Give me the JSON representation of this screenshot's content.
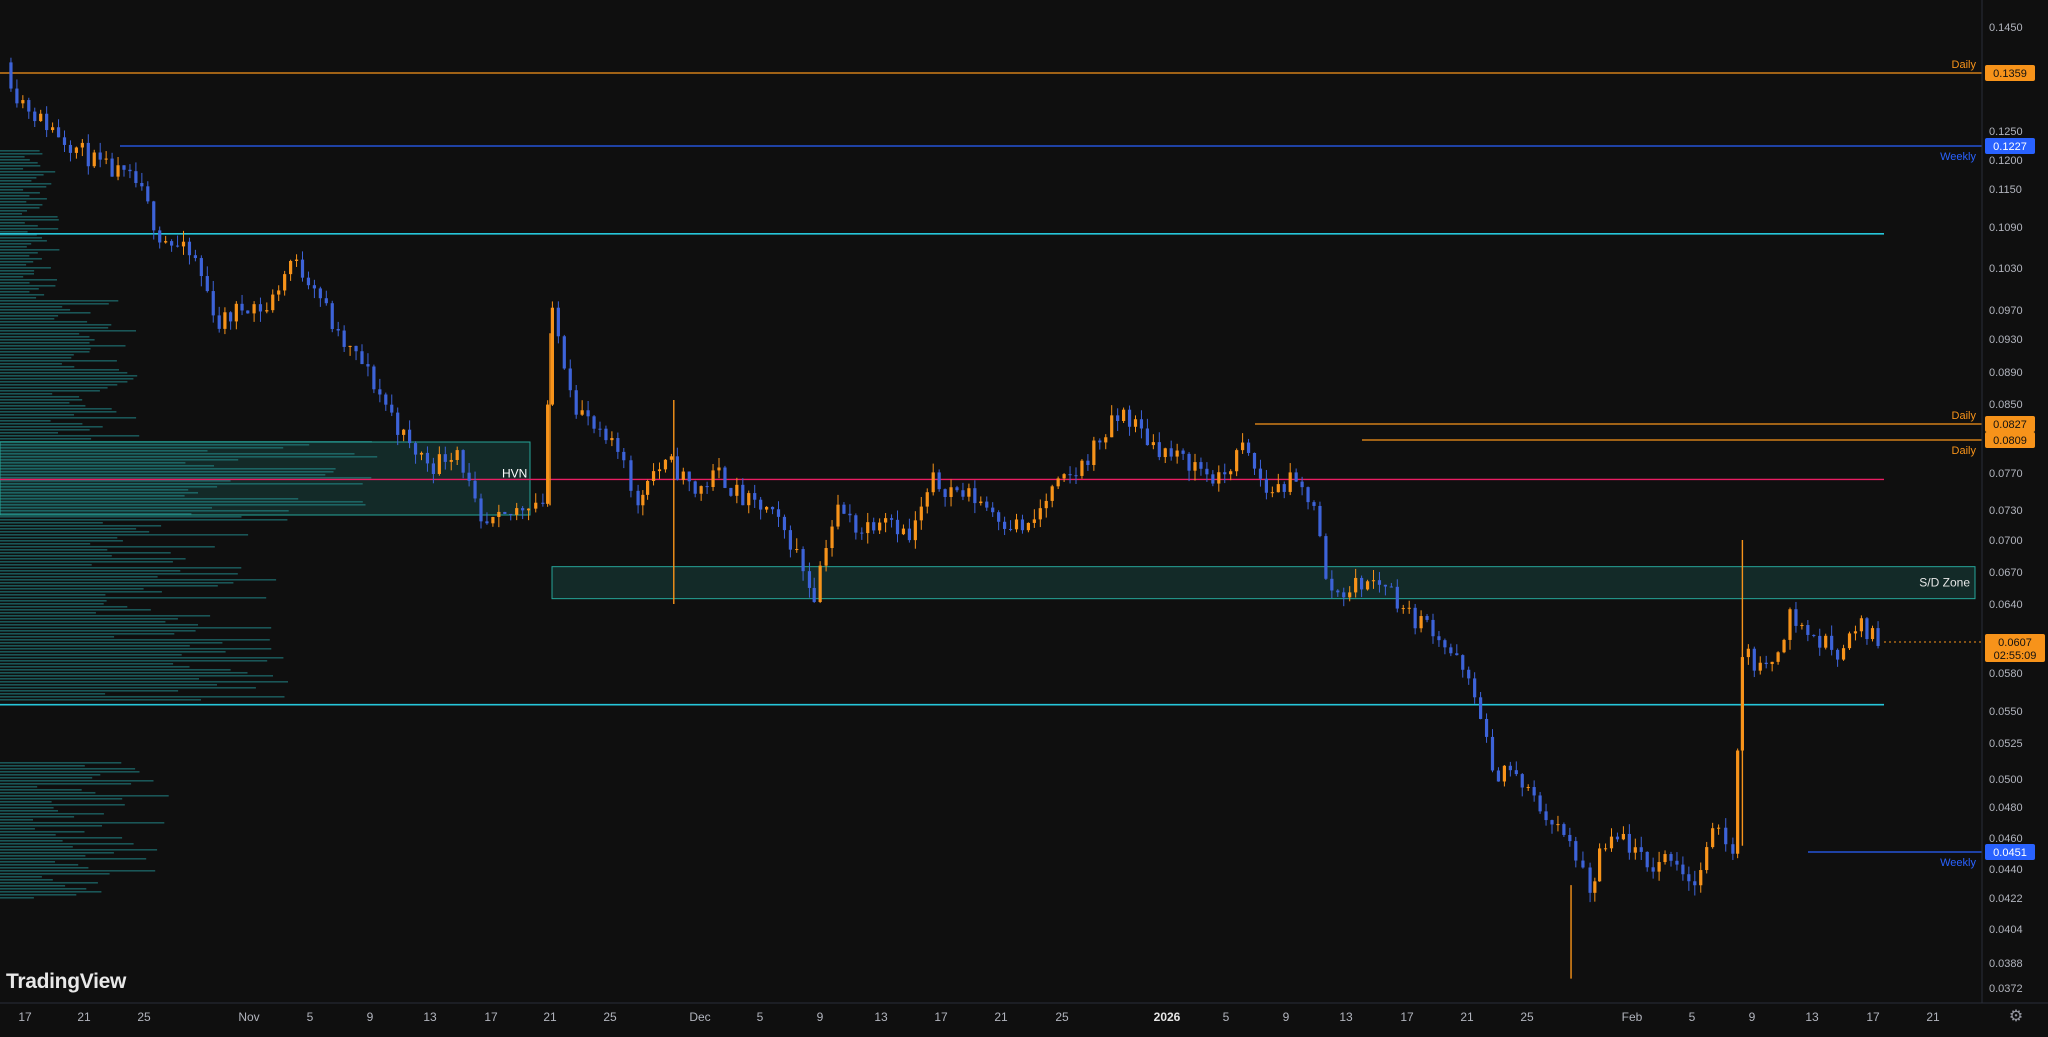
{
  "branding": {
    "logo": "TradingView"
  },
  "colors": {
    "background": "#0f0f0f",
    "candle_up": "#f7931a",
    "candle_down": "#3d63d8",
    "daily_level": "#f7931a",
    "weekly_level": "#2962ff",
    "support_line": "#26c6da",
    "hvn_line": "#e91e63",
    "zone_fill": "rgba(38,166,154,0.18)",
    "zone_border": "#26a69a",
    "volume_profile": "#1f6f70",
    "axis_text": "#b2b5be"
  },
  "icons": {
    "settings": "gear-icon"
  },
  "chart_data": {
    "type": "candlestick",
    "price_axis_ticks": [
      "0.1450",
      "0.1359",
      "0.1250",
      "0.1227",
      "0.1200",
      "0.1150",
      "0.1090",
      "0.1030",
      "0.0970",
      "0.0930",
      "0.0890",
      "0.0850",
      "0.0827",
      "0.0809",
      "0.0770",
      "0.0730",
      "0.0700",
      "0.0670",
      "0.0640",
      "0.0607",
      "0.0580",
      "0.0550",
      "0.0525",
      "0.0500",
      "0.0480",
      "0.0460",
      "0.0451",
      "0.0440",
      "0.0422",
      "0.0404",
      "0.0388",
      "0.0372"
    ],
    "time_axis_labels": [
      "17",
      "21",
      "25",
      "Nov",
      "5",
      "9",
      "13",
      "17",
      "21",
      "25",
      "Dec",
      "5",
      "9",
      "13",
      "17",
      "21",
      "25",
      "2026",
      "5",
      "9",
      "13",
      "17",
      "21",
      "25",
      "Feb",
      "5",
      "9",
      "13",
      "17",
      "21"
    ],
    "levels": [
      {
        "label": "Daily",
        "price": "0.1359",
        "kind": "daily"
      },
      {
        "label": "Weekly",
        "price": "0.1227",
        "kind": "weekly"
      },
      {
        "label": "Daily",
        "price": "0.0827",
        "kind": "daily"
      },
      {
        "label": "Daily",
        "price": "0.0809",
        "kind": "daily"
      },
      {
        "label": "Weekly",
        "price": "0.0451",
        "kind": "weekly"
      }
    ],
    "support_lines": [
      0.108,
      0.0555
    ],
    "hvn": {
      "label": "HVN",
      "price": 0.0763
    },
    "zones": [
      {
        "label": "S/D Zone",
        "top": 0.0675,
        "bottom": 0.0645
      }
    ],
    "current_price": {
      "price": "0.0607",
      "countdown": "02:55:09"
    },
    "price_path": [
      [
        0.138,
        0
      ],
      [
        0.132,
        0.5
      ],
      [
        0.127,
        1.5
      ],
      [
        0.124,
        2.5
      ],
      [
        0.119,
        4
      ],
      [
        0.116,
        5.5
      ],
      [
        0.108,
        6.5
      ],
      [
        0.104,
        8
      ],
      [
        0.095,
        9
      ],
      [
        0.098,
        10.2
      ],
      [
        0.097,
        11
      ],
      [
        0.104,
        12
      ],
      [
        0.101,
        13
      ],
      [
        0.093,
        14
      ],
      [
        0.09,
        15
      ],
      [
        0.085,
        16
      ],
      [
        0.08,
        17
      ],
      [
        0.078,
        18
      ],
      [
        0.08,
        19
      ],
      [
        0.071,
        20
      ],
      [
        0.072,
        21
      ],
      [
        0.074,
        22
      ],
      [
        0.074,
        22.6
      ],
      [
        0.096,
        23
      ],
      [
        0.085,
        24
      ],
      [
        0.081,
        25
      ],
      [
        0.079,
        26
      ],
      [
        0.073,
        26.6
      ],
      [
        0.077,
        27
      ],
      [
        0.078,
        28
      ],
      [
        0.075,
        29
      ],
      [
        0.077,
        30
      ],
      [
        0.074,
        31
      ],
      [
        0.073,
        32
      ],
      [
        0.07,
        33
      ],
      [
        0.066,
        33.8
      ],
      [
        0.065,
        34
      ],
      [
        0.07,
        34.5
      ],
      [
        0.073,
        35
      ],
      [
        0.071,
        36
      ],
      [
        0.073,
        37
      ],
      [
        0.07,
        38
      ],
      [
        0.076,
        39
      ],
      [
        0.075,
        40
      ],
      [
        0.074,
        41
      ],
      [
        0.072,
        42
      ],
      [
        0.071,
        43
      ],
      [
        0.075,
        44
      ],
      [
        0.077,
        45
      ],
      [
        0.081,
        46
      ],
      [
        0.084,
        47
      ],
      [
        0.081,
        48
      ],
      [
        0.079,
        49
      ],
      [
        0.078,
        50
      ],
      [
        0.076,
        51
      ],
      [
        0.08,
        52
      ],
      [
        0.075,
        53
      ],
      [
        0.076,
        54
      ],
      [
        0.074,
        55
      ],
      [
        0.066,
        55.5
      ],
      [
        0.065,
        56
      ],
      [
        0.066,
        57
      ],
      [
        0.066,
        58
      ],
      [
        0.063,
        59
      ],
      [
        0.062,
        60
      ],
      [
        0.059,
        61
      ],
      [
        0.055,
        62
      ],
      [
        0.05,
        62.5
      ],
      [
        0.051,
        63
      ],
      [
        0.049,
        64
      ],
      [
        0.047,
        65
      ],
      [
        0.045,
        66
      ],
      [
        0.042,
        66.6
      ],
      [
        0.045,
        67
      ],
      [
        0.046,
        68
      ],
      [
        0.044,
        69
      ],
      [
        0.045,
        70
      ],
      [
        0.043,
        71
      ],
      [
        0.047,
        72
      ],
      [
        0.045,
        72.6
      ],
      [
        0.06,
        73
      ],
      [
        0.058,
        74
      ],
      [
        0.063,
        75
      ],
      [
        0.061,
        76
      ],
      [
        0.06,
        77
      ],
      [
        0.062,
        78
      ],
      [
        0.061,
        78.7
      ]
    ]
  }
}
